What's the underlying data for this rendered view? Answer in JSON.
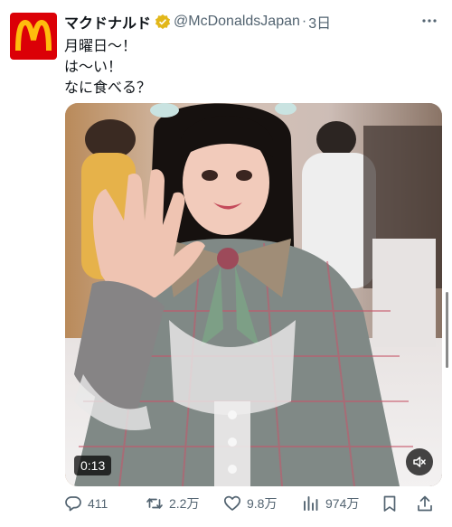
{
  "account": {
    "display_name": "マクドナルド",
    "handle": "@McDonaldsJapan",
    "separator": "·",
    "time": "3日",
    "avatar_icon": "mcdonalds-logo-icon",
    "brand_color": "#db0007",
    "verified_color": "#e2b719"
  },
  "post": {
    "lines": [
      "月曜日〜！",
      "は〜い！",
      "なに食べる？"
    ]
  },
  "media": {
    "type": "video",
    "duration": "0:13",
    "mute_icon": "speaker-muted-icon"
  },
  "actions": {
    "replies": "411",
    "reposts": "2.2万",
    "likes": "9.8万",
    "views": "974万"
  }
}
